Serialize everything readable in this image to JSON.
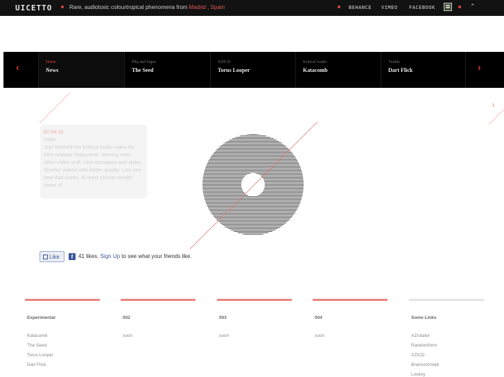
{
  "header": {
    "logo": "UICETTO",
    "tagline_main": "Rare, audiotoxic colourtropical phenomena from ",
    "tagline_city": "Madrid",
    "tagline_sep": " , ",
    "tagline_country": "Spain",
    "links": [
      "BEHANCE",
      "VIMEO",
      "FACEBOOK"
    ],
    "up_arrow": "⌃"
  },
  "slider": {
    "prev": "‹",
    "next": "›",
    "items": [
      {
        "sub": "Home",
        "title": "News"
      },
      {
        "sub": "Pliq and Sigue",
        "title": "The Seed"
      },
      {
        "sub": "XZICD",
        "title": "Torus Looper"
      },
      {
        "sub": "Kritical Audio",
        "title": "Katacomb"
      },
      {
        "sub": "Tunkle",
        "title": "Dart Flick"
      }
    ]
  },
  "post": {
    "date": "07.04.11",
    "hello": "Hello.",
    "body": "Just finished the Kritical Audio video for their release 'Katacomb'. Moving onto other video stuff, new tecniques and styles. Shorter videos with better quality. Lets see how that works. At least shorter render times :P"
  },
  "pagination": "1",
  "facebook": {
    "like_label": "Like",
    "icon": "f",
    "count_text": "41 likes.",
    "signup": "Sign Up",
    "rest": "to see what your friends like."
  },
  "footer": {
    "columns": [
      {
        "title": "Experimental",
        "items": [
          "Katacomb",
          "The Seed",
          "Torus Looper",
          "Dart Flick"
        ]
      },
      {
        "title": "002",
        "items": [
          "soon"
        ]
      },
      {
        "title": "003",
        "items": [
          "soon"
        ]
      },
      {
        "title": "004",
        "items": [
          "soon"
        ]
      },
      {
        "title": "Some Links",
        "items": [
          "AZrotator",
          "Randomform",
          "XZICD",
          "Brainstormlab",
          "Lowtoy"
        ]
      }
    ]
  },
  "colors": {
    "accent": "#d9433d",
    "topbar": "#121212",
    "slider": "#000000",
    "disc": "#4a4a4a"
  },
  "icons": {
    "contact": "contact-card-icon",
    "thumb": "thumbs-up-icon",
    "facebook": "facebook-icon"
  }
}
